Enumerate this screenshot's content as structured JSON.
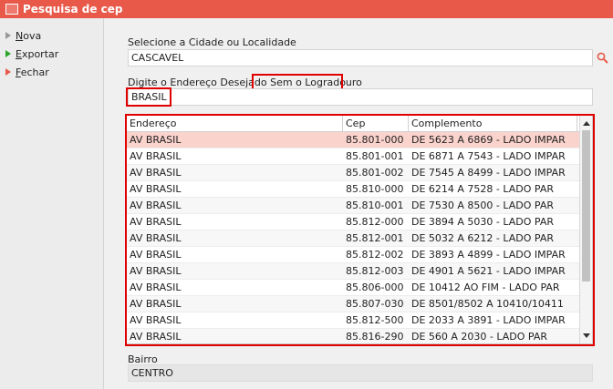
{
  "window": {
    "title": "Pesquisa de cep"
  },
  "sidebar": {
    "items": [
      {
        "first": "N",
        "rest": "ova"
      },
      {
        "first": "E",
        "rest": "xportar"
      },
      {
        "first": "F",
        "rest": "echar"
      }
    ]
  },
  "form": {
    "city_label": "Selecione a Cidade ou Localidade",
    "city_value": "CASCAVEL",
    "address_label": "Digite o Endereço Desejado",
    "no_street_label": "Sem o Logradouro",
    "address_value": "BRASIL",
    "bairro_label": "Bairro",
    "bairro_value": "CENTRO"
  },
  "grid": {
    "columns": [
      "Endereço",
      "Cep",
      "Complemento"
    ],
    "rows": [
      [
        "AV BRASIL",
        "85.801-000",
        "DE 5623 A 6869 - LADO IMPAR"
      ],
      [
        "AV BRASIL",
        "85.801-001",
        "DE 6871 A 7543 - LADO IMPAR"
      ],
      [
        "AV BRASIL",
        "85.801-002",
        "DE 7545 A 8499 - LADO IMPAR"
      ],
      [
        "AV BRASIL",
        "85.810-000",
        "DE 6214 A 7528 - LADO PAR"
      ],
      [
        "AV BRASIL",
        "85.810-001",
        "DE 7530 A 8500 - LADO PAR"
      ],
      [
        "AV BRASIL",
        "85.812-000",
        "DE 3894 A 5030 - LADO PAR"
      ],
      [
        "AV BRASIL",
        "85.812-001",
        "DE 5032 A 6212 - LADO PAR"
      ],
      [
        "AV BRASIL",
        "85.812-002",
        "DE 3893 A 4899 - LADO IMPAR"
      ],
      [
        "AV BRASIL",
        "85.812-003",
        "DE 4901 A 5621 - LADO IMPAR"
      ],
      [
        "AV BRASIL",
        "85.806-000",
        "DE 10412 AO FIM - LADO PAR"
      ],
      [
        "AV BRASIL",
        "85.807-030",
        "DE 8501/8502 A 10410/10411"
      ],
      [
        "AV BRASIL",
        "85.812-500",
        "DE 2033 A 3891 - LADO IMPAR"
      ],
      [
        "AV BRASIL",
        "85.816-290",
        "DE 560 A 2030 - LADO PAR"
      ]
    ]
  },
  "colors": {
    "title_bar": "#e8594a",
    "selected_row": "#fbd3cd",
    "highlight_border": "#e00000",
    "nova_marker": "#999999",
    "exportar_marker": "#2aa62a",
    "fechar_marker": "#e8594a"
  },
  "icons": [
    "window-icon",
    "triangle-marker-icon",
    "search-icon",
    "scroll-up-icon",
    "scroll-down-icon"
  ]
}
